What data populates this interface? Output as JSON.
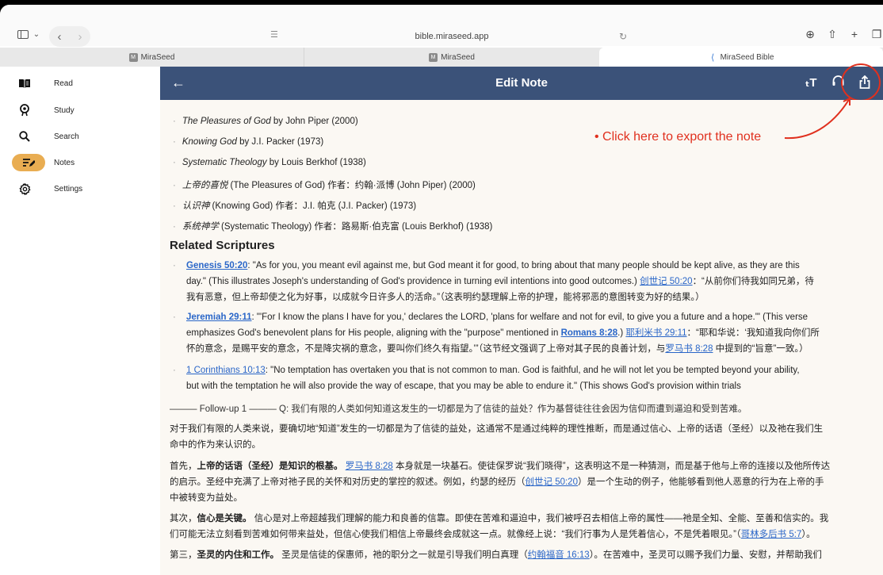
{
  "browser": {
    "url": "bible.miraseed.app",
    "tabs": [
      {
        "label": "MiraSeed",
        "favicon": "M"
      },
      {
        "label": "MiraSeed",
        "favicon": "M"
      },
      {
        "label": "MiraSeed Bible",
        "favicon": "⟨"
      }
    ]
  },
  "sidebar": {
    "items": [
      {
        "label": "Read",
        "icon": "book-icon"
      },
      {
        "label": "Study",
        "icon": "study-icon"
      },
      {
        "label": "Search",
        "icon": "search-icon"
      },
      {
        "label": "Notes",
        "icon": "notes-icon",
        "active": true
      },
      {
        "label": "Settings",
        "icon": "gear-icon"
      }
    ]
  },
  "header": {
    "title": "Edit Note",
    "icons": [
      "text-size-icon",
      "headphones-icon",
      "share-icon",
      "trash-icon"
    ]
  },
  "annotation": "• Click here to export the note",
  "books": [
    {
      "title": "The Pleasures of God",
      "rest": " by John Piper (2000)"
    },
    {
      "title": "Knowing God",
      "rest": " by J.I. Packer (1973)"
    },
    {
      "title": "Systematic Theology",
      "rest": " by Louis Berkhof (1938)"
    },
    {
      "title": "上帝的喜悦",
      "rest": " (The Pleasures of God) 作者：约翰·派博 (John Piper) (2000)"
    },
    {
      "title": "认识神",
      "rest": " (Knowing God) 作者：J.I. 帕克 (J.I. Packer) (1973)"
    },
    {
      "title": "系统神学",
      "rest": " (Systematic Theology) 作者：路易斯·伯克富 (Louis Berkhof) (1938)"
    }
  ],
  "related_heading": "Related Scriptures",
  "scriptures": [
    {
      "ref": "Genesis 50:20",
      "line1": ": \"As for you, you meant evil against me, but God meant it for good, to bring about that many people should be kept alive, as they are this",
      "line2a": "day.\" (This illustrates Joseph's understanding of God's providence in turning evil intentions into good outcomes.) ",
      "ref_zh": "创世记 50:20",
      "line2b": "：“从前你们待我如同兄弟，待",
      "line3": "我有恶意，但上帝却使之化为好事，以成就今日许多人的活命。”（这表明约瑟理解上帝的护理，能将邪恶的意图转变为好的结果。）"
    },
    {
      "ref": "Jeremiah 29:11",
      "line1": ": \"'For I know the plans I have for you,' declares the LORD, 'plans for welfare and not for evil, to give you a future and a hope.'\" (This verse",
      "line2a": "emphasizes God's benevolent plans for His people, aligning with the \"purpose\" mentioned in ",
      "ref_mid": "Romans 8:28",
      "line2b": ".) ",
      "ref_zh": "耶利米书 29:11",
      "line2c": "：“耶和华说：‘我知道我向你们所",
      "line3a": "怀的意念，是赐平安的意念，不是降灾祸的意念，要叫你们终久有指望。’”（这节经文强调了上帝对其子民的良善计划，与",
      "ref_zh2": "罗马书 8:28",
      "line3b": " 中提到的“旨意”一致。）"
    },
    {
      "ref": "1 Corinthians 10:13",
      "line1": ": \"No temptation has overtaken you that is not common to man. God is faithful, and he will not let you be tempted beyond your ability,",
      "line2": "but with the temptation he will also provide the way of escape, that you may be able to endure it.\" (This shows God's provision within trials"
    }
  ],
  "followup": "——— Follow-up 1 ——— Q: 我们有限的人类如何知道这发生的一切都是为了信徒的益处？作为基督徒往往会因为信仰而遭到逼迫和受到苦难。",
  "para1": {
    "l1": "对于我们有限的人类来说，要确切地“知道”发生的一切都是为了信徒的益处，这通常不是通过纯粹的理性推断，而是通过信心、上帝的话语（圣经）以及祂在我们生",
    "l2": "命中的作为来认识的。"
  },
  "para2": {
    "a": "首先，",
    "b": "上帝的话语（圣经）是知识的根基。",
    "ref1": "罗马书 8:28",
    "c": " 本身就是一块基石。使徒保罗说“我们晓得”，这表明这不是一种猜测，而是基于他与上帝的连接以及他所传达",
    "l2a": "的启示。圣经中充满了上帝对祂子民的关怀和对历史的掌控的叙述。例如，约瑟的经历（",
    "ref2": "创世记 50:20",
    "l2b": "）是一个生动的例子，他能够看到他人恶意的行为在上帝的手",
    "l3": "中被转变为益处。"
  },
  "para3": {
    "a": "其次，",
    "b": "信心是关键。",
    "c": " 信心是对上帝超越我们理解的能力和良善的信靠。即使在苦难和逼迫中，我们被呼召去相信上帝的属性——祂是全知、全能、至善和信实的。我",
    "l2a": "们可能无法立刻看到苦难如何带来益处，但信心使我们相信上帝最终会成就这一点。就像经上说：“我们行事为人是凭着信心，不是凭着眼见。”（",
    "ref": "哥林多后书 5:7",
    "l2b": "）。"
  },
  "para4": {
    "a": "第三，",
    "b": "圣灵的内住和工作。",
    "c": " 圣灵是信徒的保惠师，祂的职分之一就是引导我们明白真理（",
    "ref": "约翰福音 16:13",
    "d": "）。在苦难中，圣灵可以赐予我们力量、安慰，并帮助我们"
  }
}
